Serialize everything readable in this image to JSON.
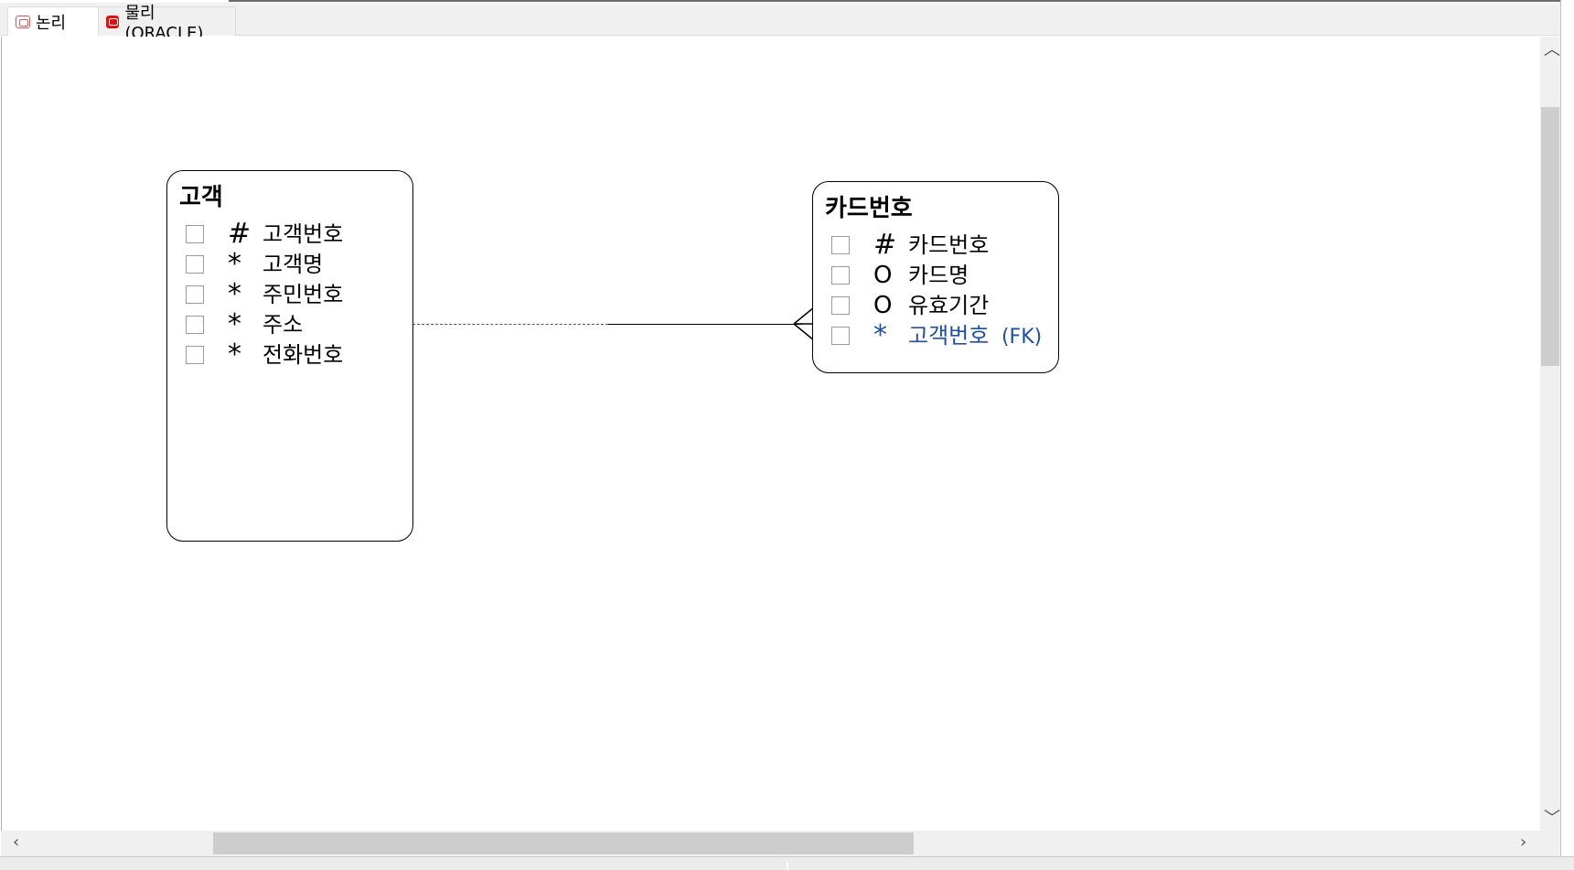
{
  "tabs": [
    {
      "label": "논리",
      "icon": "logical-model-icon",
      "active": true
    },
    {
      "label": "물리 (ORACLE)",
      "icon": "physical-model-icon",
      "active": false
    }
  ],
  "entities": {
    "customer": {
      "name": "고객",
      "attributes": [
        {
          "mark": "#",
          "name": "고객번호"
        },
        {
          "mark": "*",
          "name": "고객명"
        },
        {
          "mark": "*",
          "name": "주민번호"
        },
        {
          "mark": "*",
          "name": "주소"
        },
        {
          "mark": "*",
          "name": "전화번호"
        }
      ]
    },
    "card": {
      "name": "카드번호",
      "attributes": [
        {
          "mark": "#",
          "name": "카드번호"
        },
        {
          "mark": "O",
          "name": "카드명"
        },
        {
          "mark": "O",
          "name": "유효기간"
        },
        {
          "mark": "*",
          "name": "고객번호",
          "suffix": "(FK)"
        }
      ]
    }
  },
  "colors": {
    "foreign_key": "#1f4fa3",
    "physical_tab_icon": "#dd1111"
  }
}
